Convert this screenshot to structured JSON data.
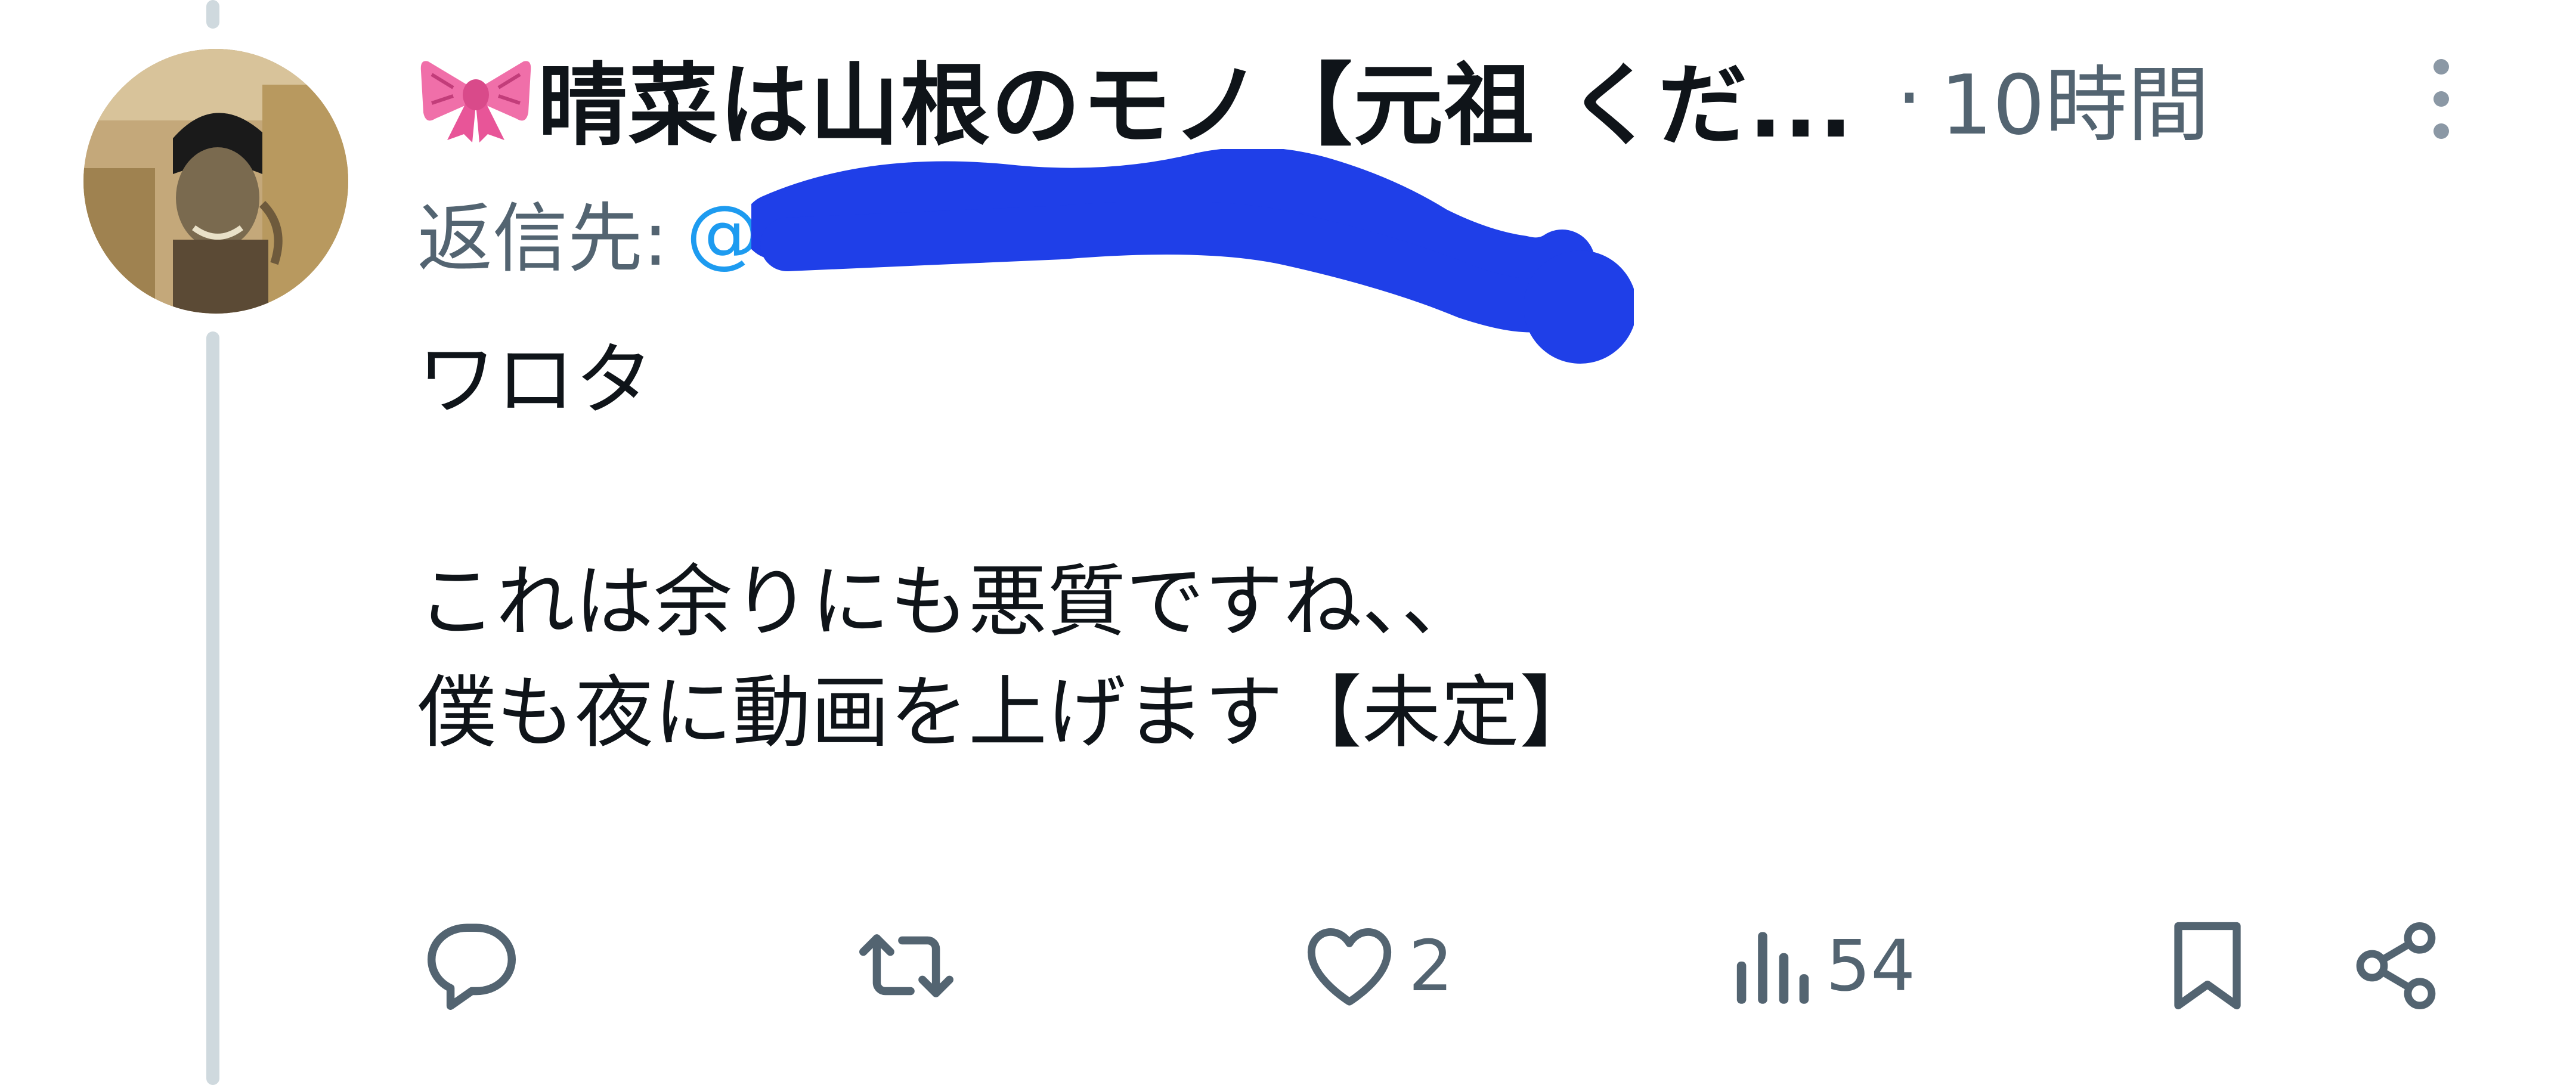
{
  "post": {
    "display_name": "晴菜は山根のモノ【元祖 くだ...",
    "separator": "·",
    "time": "10時間",
    "reply_label": "返信先:",
    "reply_handle": "@",
    "text": "ワロタ\n\nこれは余りにも悪質ですね、、\n僕も夜に動画を上げます【未定】"
  },
  "actions": {
    "like_count": "2",
    "views_count": "54"
  },
  "icons": {
    "name_emoji": "ribbon-icon",
    "more": "more-vertical-icon",
    "reply": "reply-icon",
    "retweet": "retweet-icon",
    "like": "heart-icon",
    "views": "views-chart-icon",
    "bookmark": "bookmark-icon",
    "share": "share-icon"
  },
  "colors": {
    "text": "#0f1419",
    "secondary_text": "#536471",
    "link": "#1d9bf0",
    "thread_line": "#cfd9de",
    "redaction": "#1f3fe8",
    "ribbon": "#f06fa9"
  }
}
